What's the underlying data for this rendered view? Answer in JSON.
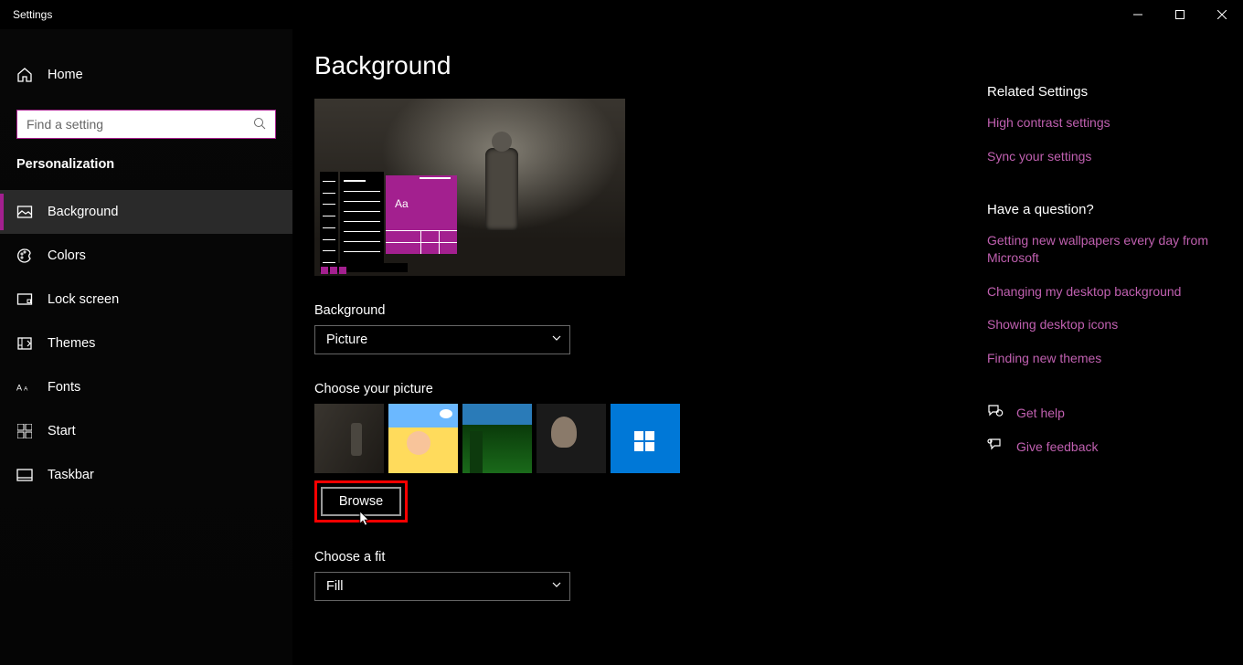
{
  "window": {
    "title": "Settings"
  },
  "sidebar": {
    "home_label": "Home",
    "search_placeholder": "Find a setting",
    "category": "Personalization",
    "items": [
      {
        "label": "Background",
        "icon": "image-icon",
        "active": true
      },
      {
        "label": "Colors",
        "icon": "palette-icon"
      },
      {
        "label": "Lock screen",
        "icon": "lockscreen-icon"
      },
      {
        "label": "Themes",
        "icon": "themes-icon"
      },
      {
        "label": "Fonts",
        "icon": "fonts-icon"
      },
      {
        "label": "Start",
        "icon": "start-icon"
      },
      {
        "label": "Taskbar",
        "icon": "taskbar-icon"
      }
    ]
  },
  "page": {
    "title": "Background",
    "preview_sample_text": "Aa",
    "background_label": "Background",
    "background_value": "Picture",
    "choose_picture_label": "Choose your picture",
    "browse_label": "Browse",
    "choose_fit_label": "Choose a fit",
    "fit_value": "Fill"
  },
  "related": {
    "heading": "Related Settings",
    "links": [
      "High contrast settings",
      "Sync your settings"
    ]
  },
  "question": {
    "heading": "Have a question?",
    "links": [
      "Getting new wallpapers every day from Microsoft",
      "Changing my desktop background",
      "Showing desktop icons",
      "Finding new themes"
    ]
  },
  "support": {
    "help": "Get help",
    "feedback": "Give feedback"
  }
}
